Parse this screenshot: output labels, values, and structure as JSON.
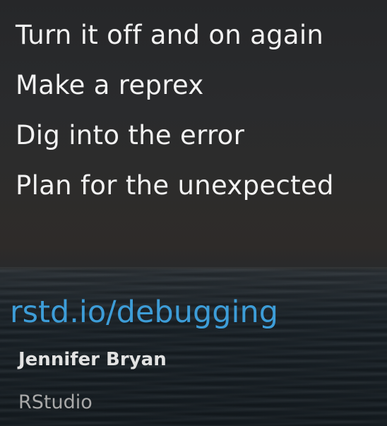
{
  "slide": {
    "bullets": [
      "Turn it off and on again",
      "Make a reprex",
      "Dig into the error",
      "Plan for the unexpected"
    ],
    "link": "rstd.io/debugging",
    "author": "Jennifer Bryan",
    "organization": "RStudio"
  },
  "colors": {
    "bullet_text": "#f2f2f2",
    "link": "#3d9dd8",
    "author": "#e2e2e2",
    "organization": "#a9a9a9"
  }
}
